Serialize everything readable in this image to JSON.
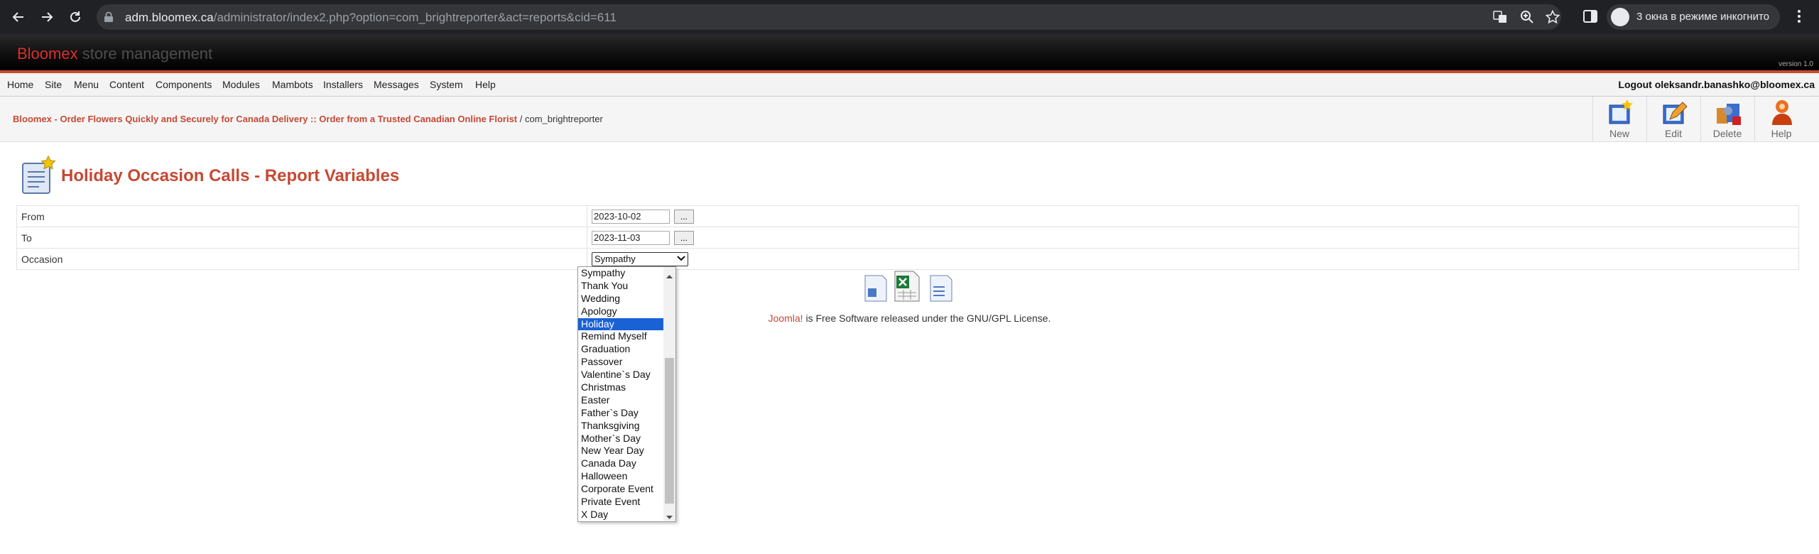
{
  "browser": {
    "url_host": "adm.bloomex.ca",
    "url_path": "/administrator/index2.php?option=com_brightreporter&act=reports&cid=611",
    "incognito_text": "3 окна в режиме инкогнито"
  },
  "header": {
    "brand": "Bloomex",
    "subtitle": "store management",
    "version": "version 1.0"
  },
  "menu": {
    "items": [
      "Home",
      "Site",
      "Menu",
      "Content",
      "Components",
      "Modules",
      "Mambots",
      "Installers",
      "Messages",
      "System",
      "Help"
    ],
    "logout": "Logout oleksandr.banashko@bloomex.ca"
  },
  "pathway": {
    "site": "Bloomex - Order Flowers Quickly and Securely for Canada Delivery :: Order from a Trusted Canadian Online Florist",
    "separator": " / ",
    "component": "com_brightreporter"
  },
  "toolbar": {
    "new_label": "New",
    "edit_label": "Edit",
    "delete_label": "Delete",
    "help_label": "Help"
  },
  "page": {
    "title": "Holiday Occasion Calls - Report Variables"
  },
  "form": {
    "from_label": "From",
    "from_value": "2023-10-02",
    "to_label": "To",
    "to_value": "2023-11-03",
    "occasion_label": "Occasion",
    "occasion_selected": "Sympathy",
    "picker_label": "..."
  },
  "dropdown": {
    "options": [
      "Sympathy",
      "Thank You",
      "Wedding",
      "Apology",
      "Holiday",
      "Remind Myself",
      "Graduation",
      "Passover",
      "Valentine`s Day",
      "Christmas",
      "Easter",
      "Father`s Day",
      "Thanksgiving",
      "Mother`s Day",
      "New Year Day",
      "Canada Day",
      "Halloween",
      "Corporate Event",
      "Private Event",
      "X Day"
    ],
    "highlighted": "Holiday"
  },
  "footer": {
    "joomla": "Joomla!",
    "rest": " is Free Software released under the GNU/GPL License."
  },
  "colors": {
    "accent": "#c64934",
    "selection": "#1a61d6",
    "chrome_bg": "#202124"
  }
}
